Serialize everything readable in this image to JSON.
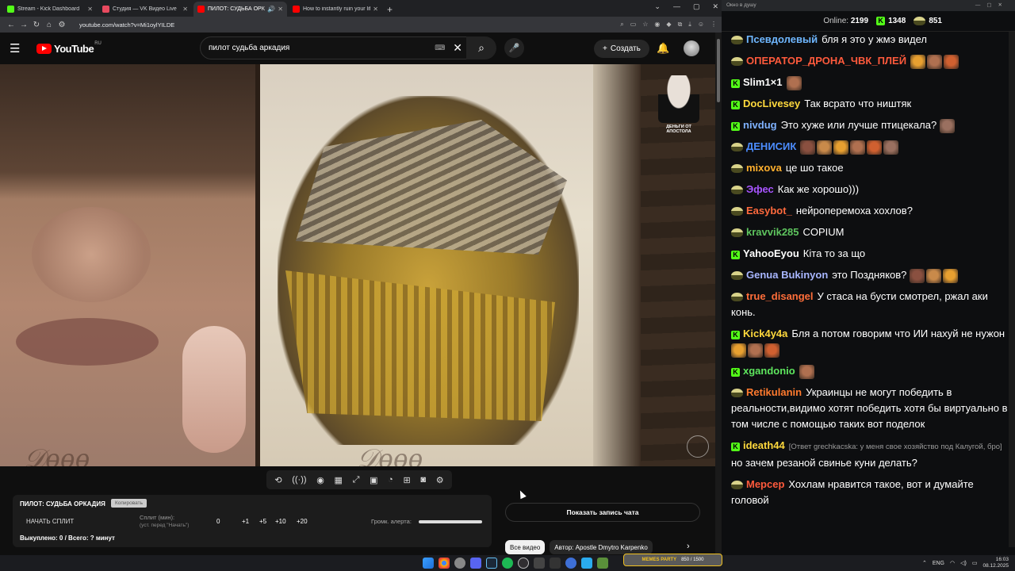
{
  "browser": {
    "tabs": [
      {
        "title": "Stream - Kick Dashboard",
        "favicon_color": "#53fc18",
        "active": false
      },
      {
        "title": "Студия — VK Видео Live",
        "favicon_color": "#e84a5f",
        "active": false
      },
      {
        "title": "ПИЛОТ: СУДЬБА ОРКАДИЯ",
        "favicon_color": "#ff0000",
        "active": true
      },
      {
        "title": "How to instantly ruin your life",
        "favicon_color": "#ff0000",
        "active": false
      }
    ],
    "url": "youtube.com/watch?v=Mi1oylYILDE"
  },
  "youtube": {
    "logo_text": "YouTube",
    "logo_region": "RU",
    "search_value": "пилот судьба аркадия",
    "create_label": "Создать"
  },
  "video": {
    "channel_caption": "ДЕНЬГИ ОТ АПОСТОЛА"
  },
  "split_panel": {
    "title": "ПИЛОТ: СУДЬБА ОРКАДИЯ",
    "copy_label": "Копировать",
    "start_label": "НАЧАТЬ СПЛИТ",
    "split_label": "Сплит (мин):",
    "split_hint": "(уст. перед \"Начать\")",
    "split_value": "0",
    "increments": [
      "+1",
      "+5",
      "+10",
      "+20"
    ],
    "volume_label": "Громк. алерта:",
    "volume_level": 1.0,
    "bought": "Выкуплено: 0 / Всего: ? минут"
  },
  "show_chat_label": "Показать запись чата",
  "chips": [
    "Все видео",
    "Автор: Apostle Dmytro Karpenko"
  ],
  "chat": {
    "window_title": "Окно в душу",
    "online_label": "Online:",
    "online_count": "2199",
    "kick_count": "1348",
    "vk_count": "851",
    "messages": [
      {
        "platform": "vk",
        "user": "Псевдолевый",
        "color": "#6fb7ff",
        "text": "бля я это у жмэ видел"
      },
      {
        "platform": "vk",
        "user": "ОПЕРАТОР_ДРОНА_ЧВК_ПЛЕЙ",
        "color": "#ff5a3c",
        "text": "",
        "emotes": 3
      },
      {
        "platform": "kick",
        "user": "Slim1×1",
        "color": "#ffffff",
        "text": "",
        "emotes": 1
      },
      {
        "platform": "kick",
        "user": "DocLivesey",
        "color": "#ffd93d",
        "text": "Так всрато что ништяк"
      },
      {
        "platform": "kick",
        "user": "nivdug",
        "color": "#7fb2ff",
        "text": "Это хуже или лучше птицекала?",
        "emotes": 1
      },
      {
        "platform": "vk",
        "user": "ДЕНИСИК",
        "color": "#4c8dff",
        "text": "",
        "emotes": 6
      },
      {
        "platform": "vk",
        "user": "mixova",
        "color": "#ffb02e",
        "text": "це шо такое"
      },
      {
        "platform": "vk",
        "user": "Эфес",
        "color": "#a855ff",
        "text": "Как же хорошо)))"
      },
      {
        "platform": "vk",
        "user": "Easybot_",
        "color": "#ff6a3d",
        "text": "нейроперемоха хохлов?"
      },
      {
        "platform": "vk",
        "user": "kravvik285",
        "color": "#5ec45e",
        "text": "COPIUM"
      },
      {
        "platform": "kick",
        "user": "YahooEyou",
        "color": "#ffffff",
        "text": "Кіта то за що"
      },
      {
        "platform": "vk",
        "user": "Genua Bukinyon",
        "color": "#a8b6ff",
        "text": "это Поздняков?",
        "emotes": 3
      },
      {
        "platform": "vk",
        "user": "true_disangel",
        "color": "#ff6e3a",
        "text": "У стаса на бусти смотрел, ржал аки конь."
      },
      {
        "platform": "kick",
        "user": "Kick4y4a",
        "color": "#ffd93d",
        "text": "Бля а потом говорим что ИИ нахуй не нужон",
        "emotes": 3
      },
      {
        "platform": "kick",
        "user": "xgandonio",
        "color": "#5ee65e",
        "text": "",
        "emotes": 1
      },
      {
        "platform": "vk",
        "user": "Retikulanin",
        "color": "#ff7a2e",
        "text": "Украинцы не могут победить в реальности,видимо хотят победить хотя бы виртуально в том числе с помощью таких вот поделок"
      },
      {
        "platform": "kick",
        "user": "ideath44",
        "color": "#ffd93d",
        "reply": "[Ответ grechkacska: у меня свое хозяйство под Калугой, бро]",
        "text": "но зачем резаной свинье куни делать?"
      },
      {
        "platform": "vk",
        "user": "Мерсер",
        "color": "#ff5a3c",
        "text": "Хохлам нравится такое, вот и думайте головой"
      }
    ]
  },
  "taskbar": {
    "memes_label": "MEMES PARTY",
    "memes_counter": "850 / 1500",
    "lang": "ENG",
    "time": "16:03",
    "date": "08.12.2025"
  }
}
